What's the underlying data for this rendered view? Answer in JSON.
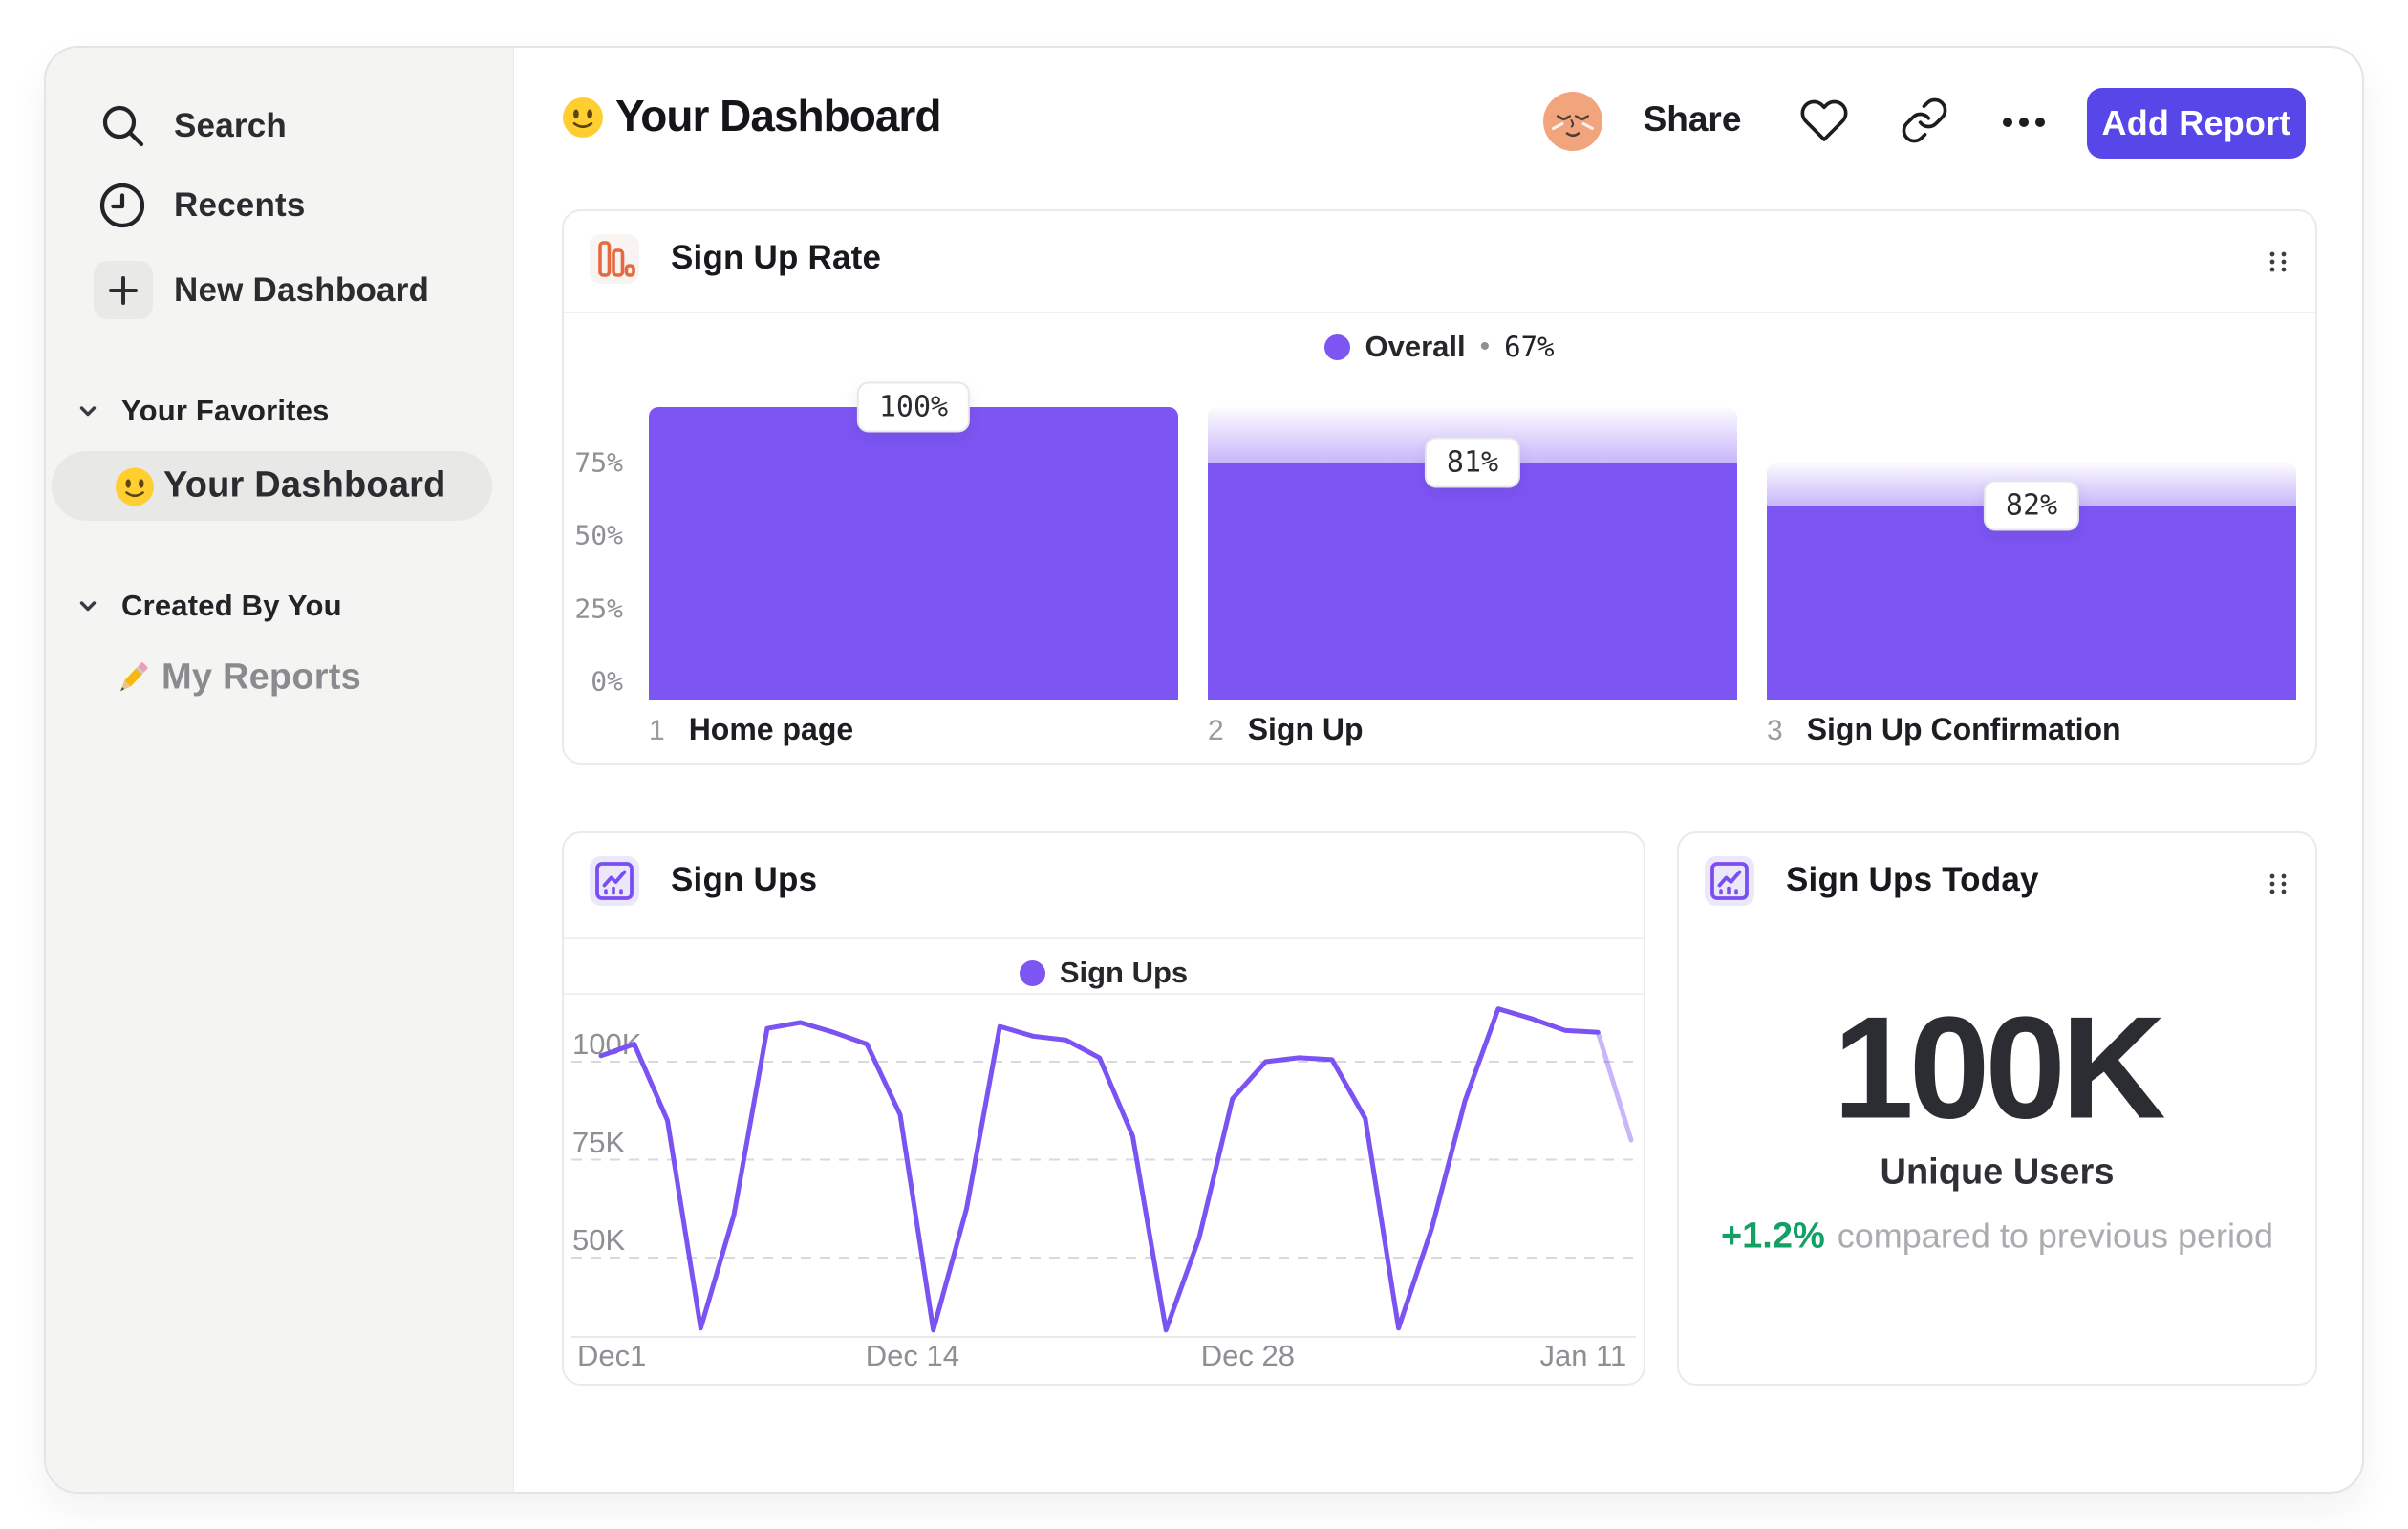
{
  "sidebar": {
    "items": [
      {
        "label": "Search",
        "icon": "search-icon"
      },
      {
        "label": "Recents",
        "icon": "clock-icon"
      },
      {
        "label": "New Dashboard",
        "icon": "plus-icon"
      }
    ],
    "sections": [
      {
        "label": "Your Favorites",
        "items": [
          {
            "label": "Your Dashboard",
            "icon": "smiley-emoji",
            "selected": true
          }
        ]
      },
      {
        "label": "Created By You",
        "items": [
          {
            "label": "My Reports",
            "icon": "pencil-emoji",
            "selected": false
          }
        ]
      }
    ]
  },
  "header": {
    "emoji": "slightly-smiling-face",
    "title": "Your Dashboard",
    "share_label": "Share",
    "add_report_label": "Add Report"
  },
  "chart_data": [
    {
      "id": "signup-rate",
      "type": "bar",
      "title": "Sign Up Rate",
      "legend": {
        "label": "Overall",
        "separator": "•",
        "value": "67%"
      },
      "ylim": [
        0,
        100
      ],
      "yticks": [
        {
          "label": "75%",
          "value": 75
        },
        {
          "label": "50%",
          "value": 50
        },
        {
          "label": "25%",
          "value": 25
        },
        {
          "label": "0%",
          "value": 0
        }
      ],
      "steps": [
        {
          "num": "1",
          "category": "Home page",
          "value": 100,
          "value_label": "100%",
          "from": 100
        },
        {
          "num": "2",
          "category": "Sign Up",
          "value": 81,
          "value_label": "81%",
          "from": 100
        },
        {
          "num": "3",
          "category": "Sign Up Confirmation",
          "value": 66.4,
          "value_label": "82%",
          "from": 81
        }
      ],
      "colors": {
        "bar": "#7d55f3"
      }
    },
    {
      "id": "signups",
      "type": "line",
      "title": "Sign Ups",
      "legend": {
        "label": "Sign Ups"
      },
      "x_ticks": [
        {
          "label": "Dec1",
          "day": 0
        },
        {
          "label": "Dec 14",
          "day": 13
        },
        {
          "label": "Dec 28",
          "day": 27
        },
        {
          "label": "Jan 11",
          "day": 41
        }
      ],
      "y_ticks": [
        {
          "label": "100K",
          "value": 100
        },
        {
          "label": "75K",
          "value": 75
        },
        {
          "label": "50K",
          "value": 50
        }
      ],
      "span_days": 43,
      "unit": "K",
      "values": [
        101.5,
        104.5,
        85,
        32,
        61,
        108.5,
        110,
        107.5,
        104.5,
        86.5,
        31.5,
        62.5,
        109,
        106.5,
        105.5,
        101,
        81,
        31.5,
        55,
        90.5,
        100,
        101,
        100.5,
        85.5,
        32,
        57.5,
        90,
        113.5,
        111,
        108,
        107.5,
        80
      ],
      "faded_tail_segments": 1,
      "colors": {
        "line": "#7a53f2"
      }
    },
    {
      "id": "signups-today",
      "type": "kpi",
      "title": "Sign Ups Today",
      "value": "100K",
      "value_label": "Unique Users",
      "delta": "+1.2%",
      "delta_positive": true,
      "note": "compared to previous period"
    }
  ],
  "colors": {
    "accent": "#5847e8",
    "purple": "#7d55f3",
    "green": "#12a065",
    "orange": "#e66a41"
  }
}
